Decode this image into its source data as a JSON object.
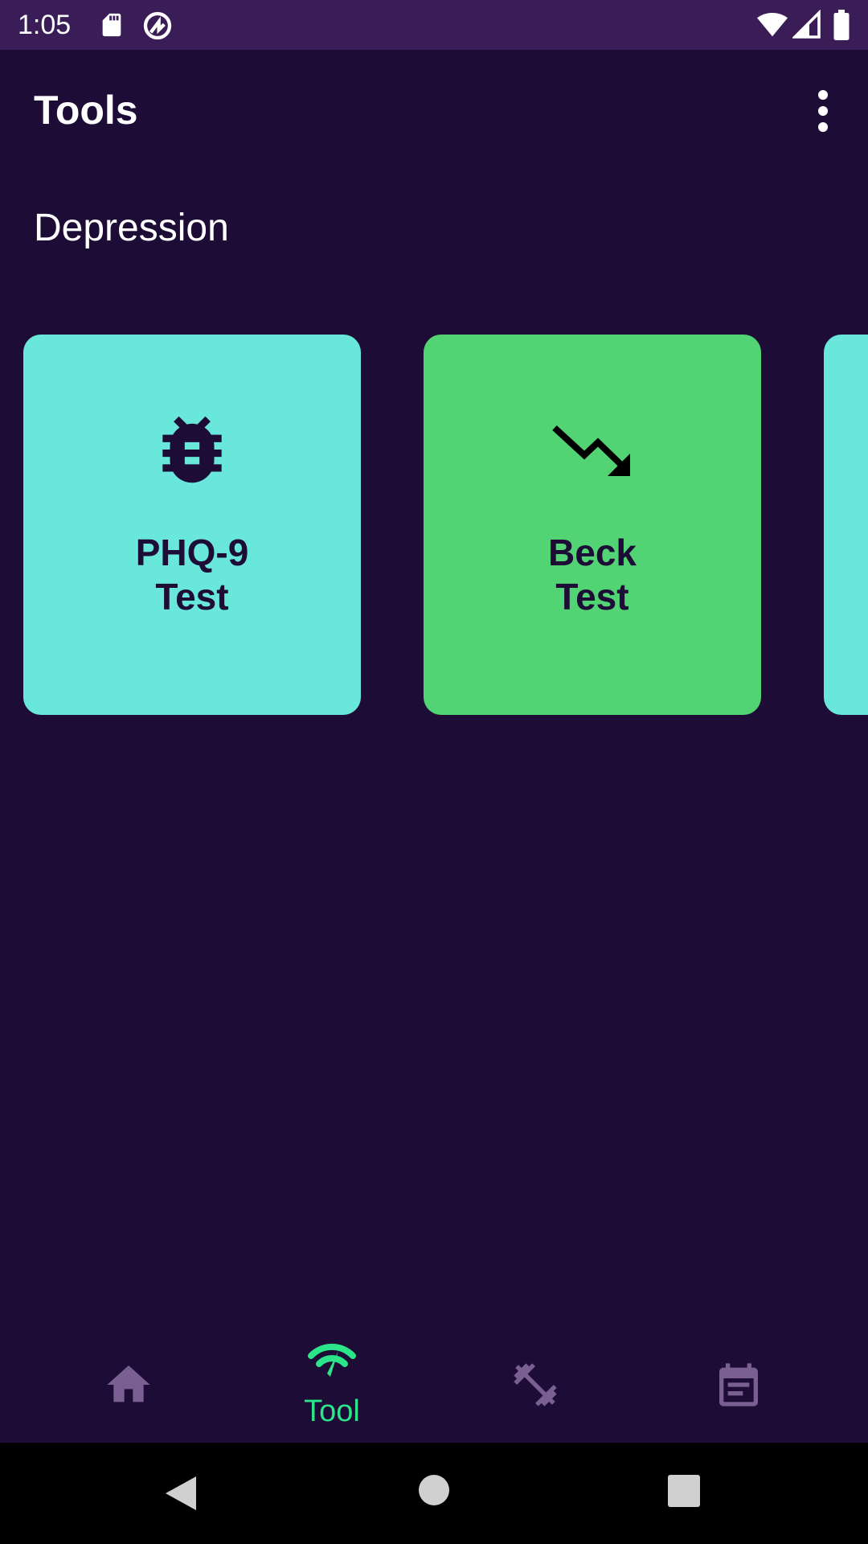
{
  "status_bar": {
    "time": "1:05",
    "icons": [
      "sd-card-icon",
      "data-saver-icon",
      "wifi-icon",
      "signal-icon",
      "battery-icon"
    ]
  },
  "app_bar": {
    "title": "Tools",
    "menu_icon": "more-vert-icon"
  },
  "section": {
    "title": "Depression"
  },
  "cards": [
    {
      "label": "PHQ-9\nTest",
      "icon": "bug-icon",
      "color": "#68e7da"
    },
    {
      "label": "Beck\nTest",
      "icon": "trending-down-icon",
      "color": "#52d374"
    },
    {
      "label": "",
      "icon": "",
      "color": "#68e7da"
    }
  ],
  "bottom_nav": {
    "items": [
      {
        "label": "",
        "icon": "home-icon",
        "active": false
      },
      {
        "label": "Tool",
        "icon": "tool-icon",
        "active": true
      },
      {
        "label": "",
        "icon": "fitness-icon",
        "active": false
      },
      {
        "label": "",
        "icon": "notes-icon",
        "active": false
      }
    ],
    "active_color": "#2ce58a",
    "inactive_color": "#7a5f93"
  },
  "system_nav": {
    "buttons": [
      "back-icon",
      "home-circle-icon",
      "recents-icon"
    ]
  }
}
